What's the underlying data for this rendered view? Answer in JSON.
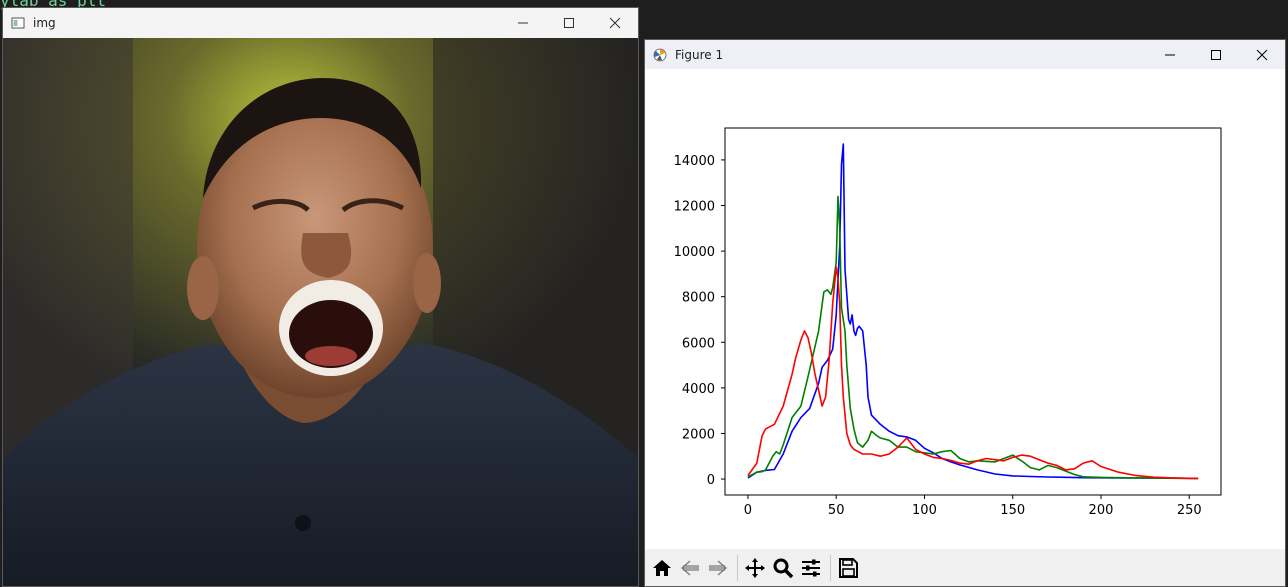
{
  "background": {
    "code_fragment": "ylab as plt"
  },
  "img_window": {
    "title": "img",
    "icon": "app-window-icon"
  },
  "figure_window": {
    "title": "Figure 1",
    "icon": "matplotlib-icon",
    "toolbar": [
      {
        "name": "home-icon"
      },
      {
        "name": "back-arrow-icon"
      },
      {
        "name": "forward-arrow-icon"
      },
      {
        "name": "pan-icon"
      },
      {
        "name": "zoom-icon"
      },
      {
        "name": "configure-subplots-icon"
      },
      {
        "name": "save-icon"
      }
    ]
  },
  "colors": {
    "blue": "#0000ff",
    "green": "#008000",
    "red": "#ff0000"
  },
  "chart_data": {
    "type": "line",
    "title": "",
    "xlabel": "",
    "ylabel": "",
    "xlim": [
      -13,
      268
    ],
    "ylim": [
      -700,
      15400
    ],
    "xticks": [
      0,
      50,
      100,
      150,
      200,
      250
    ],
    "yticks": [
      0,
      2000,
      4000,
      6000,
      8000,
      10000,
      12000,
      14000
    ],
    "grid": false,
    "series": [
      {
        "color": "#0000ff",
        "x": [
          0,
          5,
          10,
          15,
          20,
          25,
          30,
          35,
          40,
          42,
          45,
          48,
          50,
          52,
          53,
          54,
          55,
          57,
          58,
          59,
          60,
          61,
          62,
          63,
          65,
          67,
          68,
          70,
          75,
          80,
          85,
          90,
          95,
          100,
          105,
          110,
          115,
          120,
          130,
          140,
          150,
          160,
          170,
          180,
          190,
          200,
          210,
          220,
          230,
          240,
          255
        ],
        "values": [
          50,
          300,
          380,
          420,
          1100,
          2100,
          2700,
          3100,
          4200,
          4900,
          5200,
          5700,
          7200,
          10200,
          13800,
          14700,
          9200,
          7000,
          6800,
          7200,
          6500,
          6300,
          6600,
          6700,
          6500,
          5000,
          3600,
          2800,
          2400,
          2100,
          1900,
          1850,
          1700,
          1350,
          1150,
          900,
          750,
          620,
          400,
          220,
          140,
          110,
          90,
          75,
          60,
          55,
          50,
          45,
          40,
          35,
          30
        ]
      },
      {
        "color": "#008000",
        "x": [
          0,
          5,
          8,
          10,
          14,
          16,
          18,
          20,
          25,
          30,
          35,
          40,
          43,
          45,
          47,
          48,
          50,
          51,
          52,
          53,
          55,
          56,
          58,
          60,
          62,
          65,
          68,
          70,
          73,
          75,
          80,
          85,
          90,
          95,
          100,
          105,
          110,
          115,
          120,
          125,
          130,
          140,
          150,
          155,
          160,
          165,
          170,
          175,
          180,
          185,
          190,
          200,
          210,
          220,
          230,
          240,
          255
        ],
        "values": [
          100,
          300,
          320,
          400,
          1000,
          1200,
          1100,
          1500,
          2700,
          3200,
          4800,
          6500,
          8200,
          8300,
          8100,
          8400,
          9500,
          12400,
          11000,
          7500,
          6500,
          5000,
          3100,
          2200,
          1600,
          1400,
          1700,
          2100,
          1900,
          1800,
          1700,
          1400,
          1400,
          1200,
          1150,
          1100,
          1200,
          1250,
          900,
          750,
          800,
          750,
          1050,
          800,
          500,
          400,
          600,
          500,
          350,
          200,
          100,
          70,
          60,
          50,
          40,
          35,
          30
        ]
      },
      {
        "color": "#ff0000",
        "x": [
          0,
          5,
          8,
          10,
          15,
          20,
          25,
          27,
          30,
          32,
          34,
          36,
          38,
          40,
          42,
          44,
          46,
          48,
          50,
          51,
          52,
          53,
          54,
          56,
          58,
          60,
          65,
          70,
          75,
          80,
          85,
          90,
          95,
          100,
          105,
          110,
          115,
          120,
          125,
          130,
          135,
          140,
          145,
          150,
          155,
          160,
          165,
          170,
          175,
          180,
          185,
          190,
          195,
          200,
          210,
          220,
          230,
          240,
          255
        ],
        "values": [
          150,
          700,
          1900,
          2200,
          2400,
          3200,
          4600,
          5300,
          6100,
          6500,
          6200,
          5500,
          4600,
          3900,
          3200,
          3600,
          5200,
          7700,
          9300,
          8800,
          7700,
          5000,
          3600,
          2000,
          1500,
          1300,
          1100,
          1100,
          1000,
          1100,
          1400,
          1800,
          1300,
          1100,
          950,
          900,
          820,
          700,
          650,
          800,
          900,
          850,
          800,
          950,
          1050,
          1000,
          850,
          700,
          600,
          400,
          450,
          700,
          800,
          550,
          300,
          150,
          80,
          50,
          30
        ]
      }
    ]
  }
}
